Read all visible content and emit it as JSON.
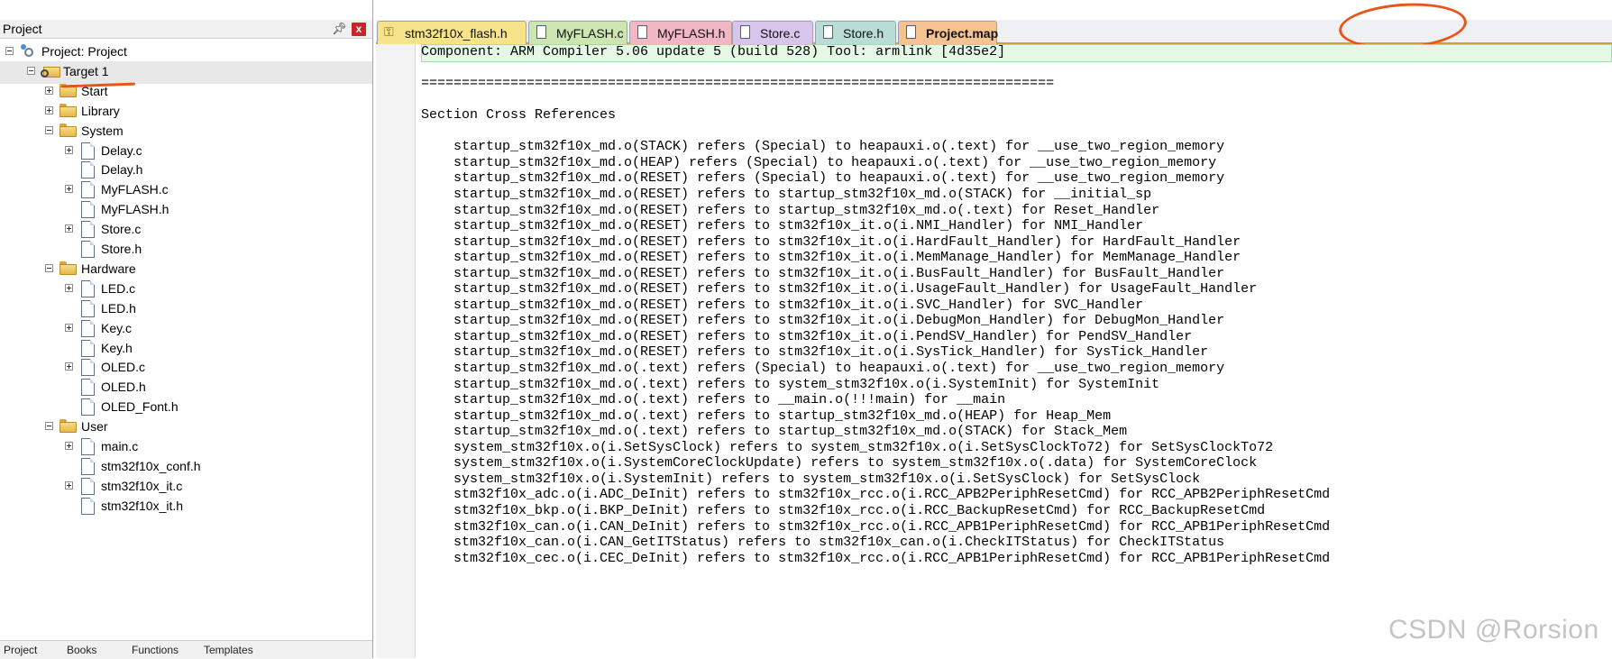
{
  "project_panel": {
    "title": "Project",
    "pin_icon": "pin-icon",
    "close_label": "x",
    "tree": [
      {
        "label": "Project: Project",
        "type": "project",
        "depth": 0,
        "toggle": "minus"
      },
      {
        "label": "Target 1",
        "type": "target",
        "depth": 1,
        "toggle": "minus",
        "selected": true
      },
      {
        "label": "Start",
        "type": "folder",
        "depth": 2,
        "toggle": "plus"
      },
      {
        "label": "Library",
        "type": "folder",
        "depth": 2,
        "toggle": "plus"
      },
      {
        "label": "System",
        "type": "folder",
        "depth": 2,
        "toggle": "minus"
      },
      {
        "label": "Delay.c",
        "type": "file",
        "depth": 3,
        "toggle": "plus"
      },
      {
        "label": "Delay.h",
        "type": "file",
        "depth": 3,
        "toggle": "none"
      },
      {
        "label": "MyFLASH.c",
        "type": "file",
        "depth": 3,
        "toggle": "plus"
      },
      {
        "label": "MyFLASH.h",
        "type": "file",
        "depth": 3,
        "toggle": "none"
      },
      {
        "label": "Store.c",
        "type": "file",
        "depth": 3,
        "toggle": "plus"
      },
      {
        "label": "Store.h",
        "type": "file",
        "depth": 3,
        "toggle": "none"
      },
      {
        "label": "Hardware",
        "type": "folder",
        "depth": 2,
        "toggle": "minus"
      },
      {
        "label": "LED.c",
        "type": "file",
        "depth": 3,
        "toggle": "plus"
      },
      {
        "label": "LED.h",
        "type": "file",
        "depth": 3,
        "toggle": "none"
      },
      {
        "label": "Key.c",
        "type": "file",
        "depth": 3,
        "toggle": "plus"
      },
      {
        "label": "Key.h",
        "type": "file",
        "depth": 3,
        "toggle": "none"
      },
      {
        "label": "OLED.c",
        "type": "file",
        "depth": 3,
        "toggle": "plus"
      },
      {
        "label": "OLED.h",
        "type": "file",
        "depth": 3,
        "toggle": "none"
      },
      {
        "label": "OLED_Font.h",
        "type": "file",
        "depth": 3,
        "toggle": "none"
      },
      {
        "label": "User",
        "type": "folder",
        "depth": 2,
        "toggle": "minus"
      },
      {
        "label": "main.c",
        "type": "file",
        "depth": 3,
        "toggle": "plus"
      },
      {
        "label": "stm32f10x_conf.h",
        "type": "file",
        "depth": 3,
        "toggle": "none"
      },
      {
        "label": "stm32f10x_it.c",
        "type": "file",
        "depth": 3,
        "toggle": "plus"
      },
      {
        "label": "stm32f10x_it.h",
        "type": "file",
        "depth": 3,
        "toggle": "none"
      }
    ],
    "bottom_tabs": [
      "Project",
      "Books",
      "Functions",
      "Templates"
    ]
  },
  "editor": {
    "tabs": [
      {
        "label": "stm32f10x_flash.h",
        "color": "#f7e48a",
        "icon": "key-icon"
      },
      {
        "label": "MyFLASH.c",
        "color": "#cde6b0",
        "icon": "file-icon"
      },
      {
        "label": "MyFLASH.h",
        "color": "#f3b6c4",
        "icon": "file-icon"
      },
      {
        "label": "Store.c",
        "color": "#d8c5ec",
        "icon": "file-icon"
      },
      {
        "label": "Store.h",
        "color": "#b9dcd6",
        "icon": "file-icon"
      },
      {
        "label": "Project.map",
        "color": "#f6c28f",
        "icon": "file-icon",
        "active": true
      }
    ],
    "lines": [
      "Component: ARM Compiler 5.06 update 5 (build 528) Tool: armlink [4d35e2]",
      "",
      "==============================================================================",
      "",
      "Section Cross References",
      "",
      "    startup_stm32f10x_md.o(STACK) refers (Special) to heapauxi.o(.text) for __use_two_region_memory",
      "    startup_stm32f10x_md.o(HEAP) refers (Special) to heapauxi.o(.text) for __use_two_region_memory",
      "    startup_stm32f10x_md.o(RESET) refers (Special) to heapauxi.o(.text) for __use_two_region_memory",
      "    startup_stm32f10x_md.o(RESET) refers to startup_stm32f10x_md.o(STACK) for __initial_sp",
      "    startup_stm32f10x_md.o(RESET) refers to startup_stm32f10x_md.o(.text) for Reset_Handler",
      "    startup_stm32f10x_md.o(RESET) refers to stm32f10x_it.o(i.NMI_Handler) for NMI_Handler",
      "    startup_stm32f10x_md.o(RESET) refers to stm32f10x_it.o(i.HardFault_Handler) for HardFault_Handler",
      "    startup_stm32f10x_md.o(RESET) refers to stm32f10x_it.o(i.MemManage_Handler) for MemManage_Handler",
      "    startup_stm32f10x_md.o(RESET) refers to stm32f10x_it.o(i.BusFault_Handler) for BusFault_Handler",
      "    startup_stm32f10x_md.o(RESET) refers to stm32f10x_it.o(i.UsageFault_Handler) for UsageFault_Handler",
      "    startup_stm32f10x_md.o(RESET) refers to stm32f10x_it.o(i.SVC_Handler) for SVC_Handler",
      "    startup_stm32f10x_md.o(RESET) refers to stm32f10x_it.o(i.DebugMon_Handler) for DebugMon_Handler",
      "    startup_stm32f10x_md.o(RESET) refers to stm32f10x_it.o(i.PendSV_Handler) for PendSV_Handler",
      "    startup_stm32f10x_md.o(RESET) refers to stm32f10x_it.o(i.SysTick_Handler) for SysTick_Handler",
      "    startup_stm32f10x_md.o(.text) refers (Special) to heapauxi.o(.text) for __use_two_region_memory",
      "    startup_stm32f10x_md.o(.text) refers to system_stm32f10x.o(i.SystemInit) for SystemInit",
      "    startup_stm32f10x_md.o(.text) refers to __main.o(!!!main) for __main",
      "    startup_stm32f10x_md.o(.text) refers to startup_stm32f10x_md.o(HEAP) for Heap_Mem",
      "    startup_stm32f10x_md.o(.text) refers to startup_stm32f10x_md.o(STACK) for Stack_Mem",
      "    system_stm32f10x.o(i.SetSysClock) refers to system_stm32f10x.o(i.SetSysClockTo72) for SetSysClockTo72",
      "    system_stm32f10x.o(i.SystemCoreClockUpdate) refers to system_stm32f10x.o(.data) for SystemCoreClock",
      "    system_stm32f10x.o(i.SystemInit) refers to system_stm32f10x.o(i.SetSysClock) for SetSysClock",
      "    stm32f10x_adc.o(i.ADC_DeInit) refers to stm32f10x_rcc.o(i.RCC_APB2PeriphResetCmd) for RCC_APB2PeriphResetCmd",
      "    stm32f10x_bkp.o(i.BKP_DeInit) refers to stm32f10x_rcc.o(i.RCC_BackupResetCmd) for RCC_BackupResetCmd",
      "    stm32f10x_can.o(i.CAN_DeInit) refers to stm32f10x_rcc.o(i.RCC_APB1PeriphResetCmd) for RCC_APB1PeriphResetCmd",
      "    stm32f10x_can.o(i.CAN_GetITStatus) refers to stm32f10x_can.o(i.CheckITStatus) for CheckITStatus",
      "    stm32f10x_cec.o(i.CEC_DeInit) refers to stm32f10x_rcc.o(i.RCC_APB1PeriphResetCmd) for RCC_APB1PeriphResetCmd"
    ]
  },
  "watermark": "CSDN @Rorsion",
  "colors": {
    "annotation": "#e8551b",
    "first_line_highlight": "#e6f7e6"
  }
}
